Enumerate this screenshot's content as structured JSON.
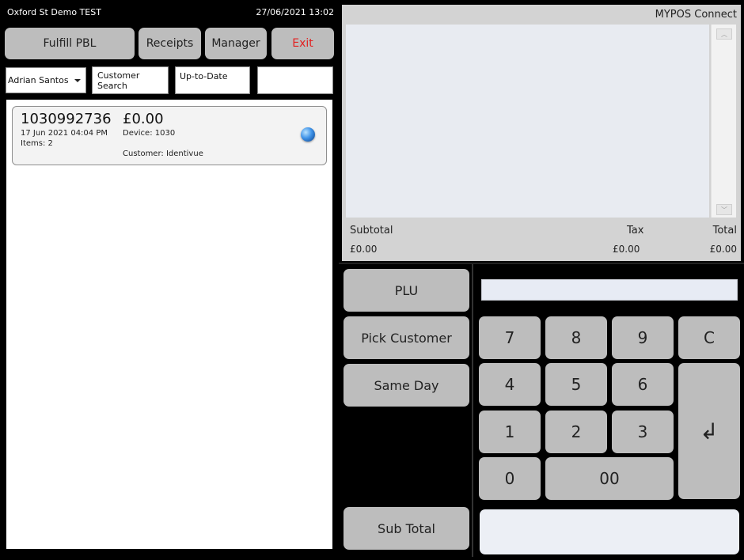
{
  "topbar": {
    "store": "Oxford St Demo TEST",
    "datetime": "27/06/2021 13:02"
  },
  "actions": {
    "fulfill": "Fulfill PBL",
    "receipts": "Receipts",
    "manager": "Manager",
    "exit": "Exit"
  },
  "filters": {
    "staff": "Adrian Santos",
    "customer_search": "Customer Search",
    "status": "Up-to-Date",
    "extra": ""
  },
  "orders": [
    {
      "number": "1030992736",
      "amount": "£0.00",
      "date": "17 Jun 2021 04:04 PM",
      "items": "Items: 2",
      "device": "Device: 1030",
      "customer": "Customer: Identivue"
    }
  ],
  "receipt": {
    "brand": "MYPOS Connect",
    "labels": {
      "subtotal": "Subtotal",
      "tax": "Tax",
      "total": "Total"
    },
    "values": {
      "subtotal": "£0.00",
      "tax": "£0.00",
      "total": "£0.00"
    }
  },
  "functions": {
    "plu": "PLU",
    "pick_customer": "Pick Customer",
    "same_day": "Same Day",
    "sub_total": "Sub Total"
  },
  "keypad": {
    "k7": "7",
    "k8": "8",
    "k9": "9",
    "clear": "C",
    "k4": "4",
    "k5": "5",
    "k6": "6",
    "k1": "1",
    "k2": "2",
    "k3": "3",
    "k0": "0",
    "k00": "00",
    "enter": "↲"
  },
  "colors": {
    "accent_exit": "#e22222",
    "status_dot": "#3f93e8"
  }
}
